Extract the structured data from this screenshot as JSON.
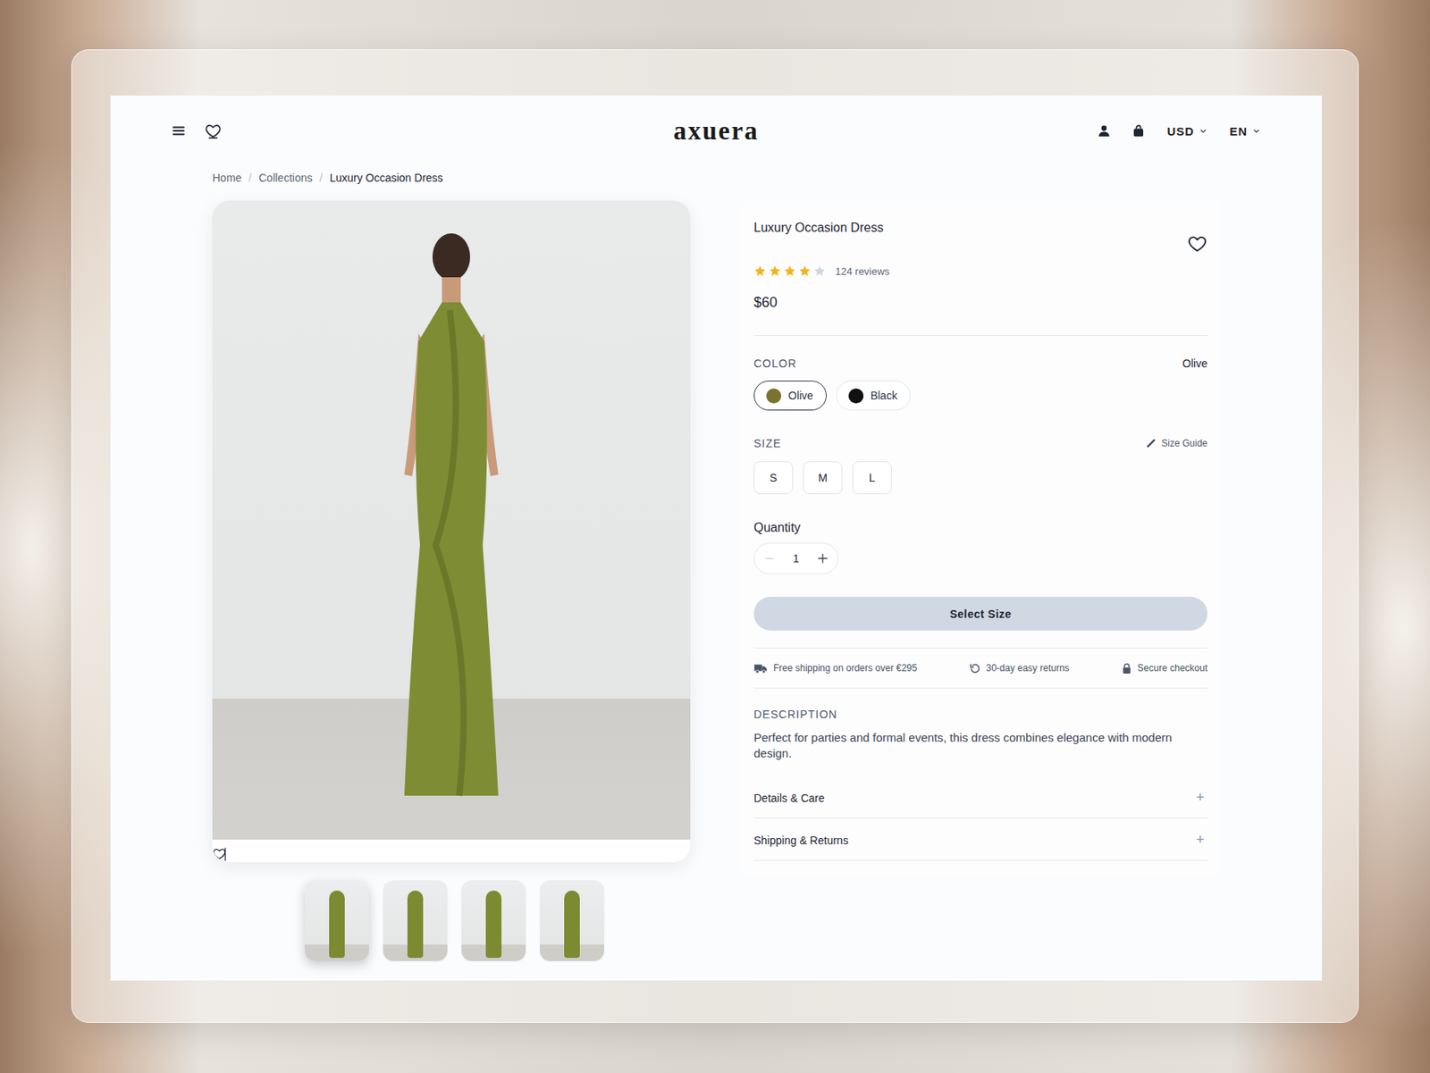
{
  "header": {
    "logo": "axuera",
    "currency": "USD",
    "language": "EN"
  },
  "breadcrumb": {
    "separator": "/",
    "items": [
      {
        "label": "Home",
        "current": false
      },
      {
        "label": "Collections",
        "current": false
      },
      {
        "label": "Luxury Occasion Dress",
        "current": true
      }
    ]
  },
  "product": {
    "title": "Luxury Occasion Dress",
    "stars": 4,
    "reviews": "124 reviews",
    "price": "$60",
    "favorite": false
  },
  "color": {
    "label": "COLOR",
    "value": "Olive",
    "options": [
      {
        "label": "Olive",
        "color": "#7b7230",
        "selected": true
      },
      {
        "label": "Black",
        "color": "#111111",
        "selected": false
      }
    ]
  },
  "size": {
    "label": "SIZE",
    "guide": "Size Guide",
    "options": [
      {
        "label": "S",
        "selected": false
      },
      {
        "label": "M",
        "selected": false
      },
      {
        "label": "L",
        "selected": false
      }
    ]
  },
  "quantity": {
    "label": "Quantity",
    "value": "1"
  },
  "add_button": {
    "label": "Select Size",
    "disabled": true
  },
  "perks": [
    "Free shipping on orders over €295",
    "30-day easy returns",
    "Secure checkout"
  ],
  "description": {
    "label": "DESCRIPTION",
    "text": "Perfect for parties and formal events, this dress combines elegance with modern design."
  },
  "accordions": [
    {
      "label": "Details & Care",
      "toggle": "+",
      "expanded": false
    },
    {
      "label": "Shipping & Returns",
      "toggle": "+",
      "expanded": false
    }
  ],
  "gallery": {
    "thumbnails": [
      {
        "selected": true
      },
      {
        "selected": false
      },
      {
        "selected": false
      },
      {
        "selected": false
      }
    ]
  }
}
